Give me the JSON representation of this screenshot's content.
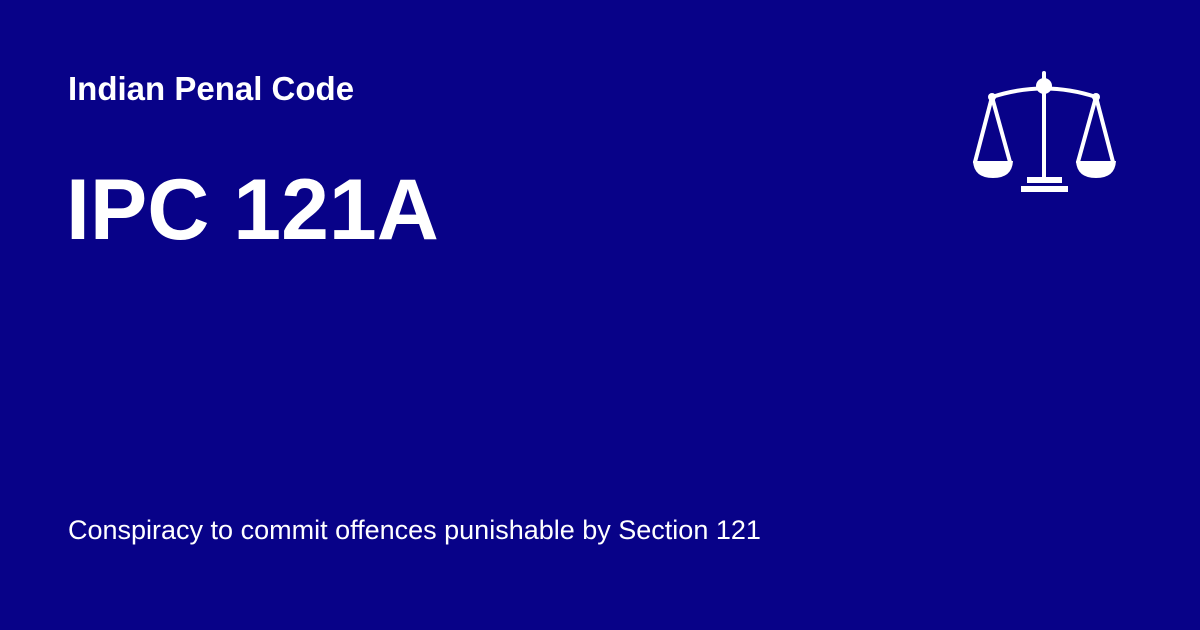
{
  "card": {
    "kicker": "Indian Penal Code",
    "headline": "IPC 121A",
    "description": "Conspiracy to commit offences punishable by Section 121"
  },
  "icons": {
    "justice": "scales-of-justice-icon"
  },
  "colors": {
    "background": "#080288",
    "text": "#ffffff"
  }
}
